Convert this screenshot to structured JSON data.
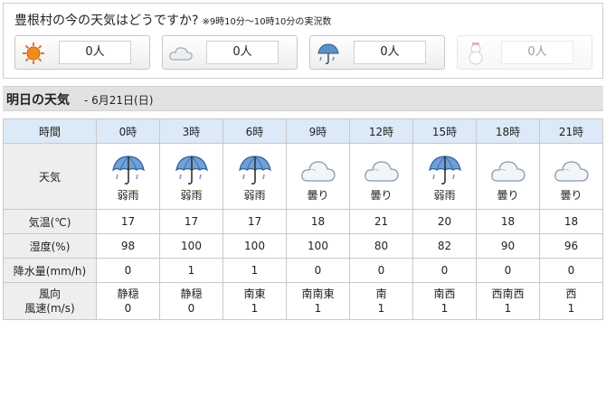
{
  "vote": {
    "title": "豊根村の今の天気はどうですか?",
    "note": "※9時10分～10時10分の実況数",
    "buttons": [
      {
        "icon": "sun-icon",
        "count": "0人",
        "enabled": true
      },
      {
        "icon": "cloud-icon",
        "count": "0人",
        "enabled": true
      },
      {
        "icon": "umbrella-rain-icon",
        "count": "0人",
        "enabled": true
      },
      {
        "icon": "snowman-icon",
        "count": "0人",
        "enabled": false
      }
    ]
  },
  "tomorrow": {
    "title": "明日の天気",
    "date": "- 6月21日(日)"
  },
  "table": {
    "row_labels": {
      "time": "時間",
      "weather": "天気",
      "temp": "気温(℃)",
      "humidity": "湿度(%)",
      "precip": "降水量(mm/h)",
      "wind_dir": "風向",
      "wind_speed": "風速(m/s)"
    },
    "columns": [
      {
        "time": "0時",
        "icon": "umbrella-icon",
        "weather": "弱雨",
        "temp": "17",
        "humidity": "98",
        "precip": "0",
        "wind_dir": "静穏",
        "wind_speed": "0"
      },
      {
        "time": "3時",
        "icon": "umbrella-icon",
        "weather": "弱雨",
        "temp": "17",
        "humidity": "100",
        "precip": "1",
        "wind_dir": "静穏",
        "wind_speed": "0"
      },
      {
        "time": "6時",
        "icon": "umbrella-icon",
        "weather": "弱雨",
        "temp": "17",
        "humidity": "100",
        "precip": "1",
        "wind_dir": "南東",
        "wind_speed": "1"
      },
      {
        "time": "9時",
        "icon": "cloud-icon",
        "weather": "曇り",
        "temp": "18",
        "humidity": "100",
        "precip": "0",
        "wind_dir": "南南東",
        "wind_speed": "1"
      },
      {
        "time": "12時",
        "icon": "cloud-icon",
        "weather": "曇り",
        "temp": "21",
        "humidity": "80",
        "precip": "0",
        "wind_dir": "南",
        "wind_speed": "1"
      },
      {
        "time": "15時",
        "icon": "umbrella-icon",
        "weather": "弱雨",
        "temp": "20",
        "humidity": "82",
        "precip": "0",
        "wind_dir": "南西",
        "wind_speed": "1"
      },
      {
        "time": "18時",
        "icon": "cloud-icon",
        "weather": "曇り",
        "temp": "18",
        "humidity": "90",
        "precip": "0",
        "wind_dir": "西南西",
        "wind_speed": "1"
      },
      {
        "time": "21時",
        "icon": "cloud-icon",
        "weather": "曇り",
        "temp": "18",
        "humidity": "96",
        "precip": "0",
        "wind_dir": "西",
        "wind_speed": "1"
      }
    ]
  }
}
